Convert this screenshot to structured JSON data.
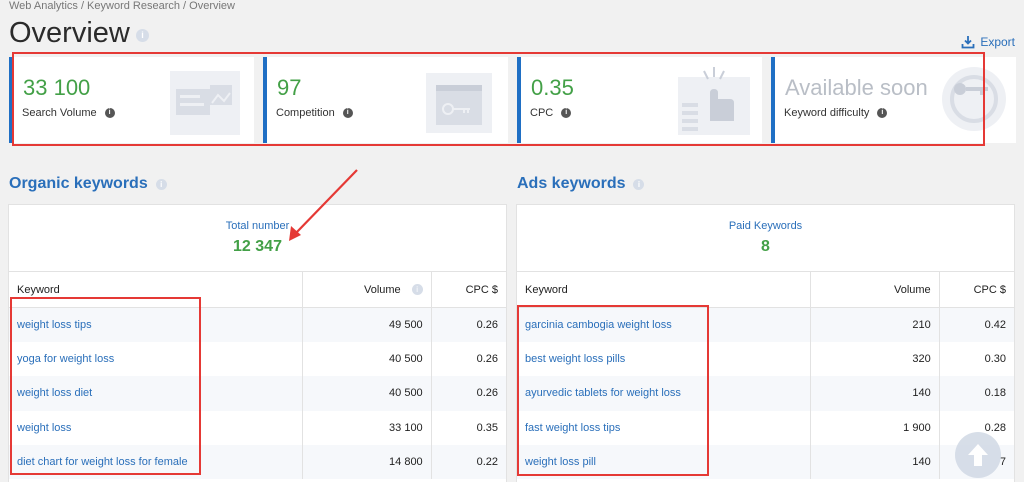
{
  "breadcrumb": "Web Analytics / Keyword Research / Overview",
  "title": "Overview",
  "export_label": "Export",
  "colors": {
    "accent": "#1f6fc4",
    "link": "#2a6fba",
    "positive": "#43a047",
    "highlight": "#e53935"
  },
  "kpis": [
    {
      "value": "33 100",
      "label": "Search Volume",
      "icon": "report-icon"
    },
    {
      "value": "97",
      "label": "Competition",
      "icon": "key-card-icon"
    },
    {
      "value": "0.35",
      "label": "CPC",
      "icon": "click-hand-icon"
    },
    {
      "value": "Available soon",
      "label": "Keyword difficulty",
      "icon": "keys-icon"
    }
  ],
  "organic": {
    "title": "Organic keywords",
    "summary_label": "Total number",
    "summary_value": "12 347",
    "headers": {
      "keyword": "Keyword",
      "volume": "Volume",
      "cpc": "CPC $"
    },
    "rows": [
      {
        "keyword": "weight loss tips",
        "volume": "49 500",
        "cpc": "0.26"
      },
      {
        "keyword": "yoga for weight loss",
        "volume": "40 500",
        "cpc": "0.26"
      },
      {
        "keyword": "weight loss diet",
        "volume": "40 500",
        "cpc": "0.26"
      },
      {
        "keyword": "weight loss",
        "volume": "33 100",
        "cpc": "0.35"
      },
      {
        "keyword": "diet chart for weight loss for female",
        "volume": "14 800",
        "cpc": "0.22"
      }
    ]
  },
  "ads": {
    "title": "Ads keywords",
    "summary_label": "Paid Keywords",
    "summary_value": "8",
    "headers": {
      "keyword": "Keyword",
      "volume": "Volume",
      "cpc": "CPC $"
    },
    "rows": [
      {
        "keyword": "garcinia cambogia weight loss",
        "volume": "210",
        "cpc": "0.42"
      },
      {
        "keyword": "best weight loss pills",
        "volume": "320",
        "cpc": "0.30"
      },
      {
        "keyword": "ayurvedic tablets for weight loss",
        "volume": "140",
        "cpc": "0.18"
      },
      {
        "keyword": "fast weight loss tips",
        "volume": "1 900",
        "cpc": "0.28"
      },
      {
        "keyword": "weight loss pill",
        "volume": "140",
        "cpc": "7"
      }
    ]
  }
}
